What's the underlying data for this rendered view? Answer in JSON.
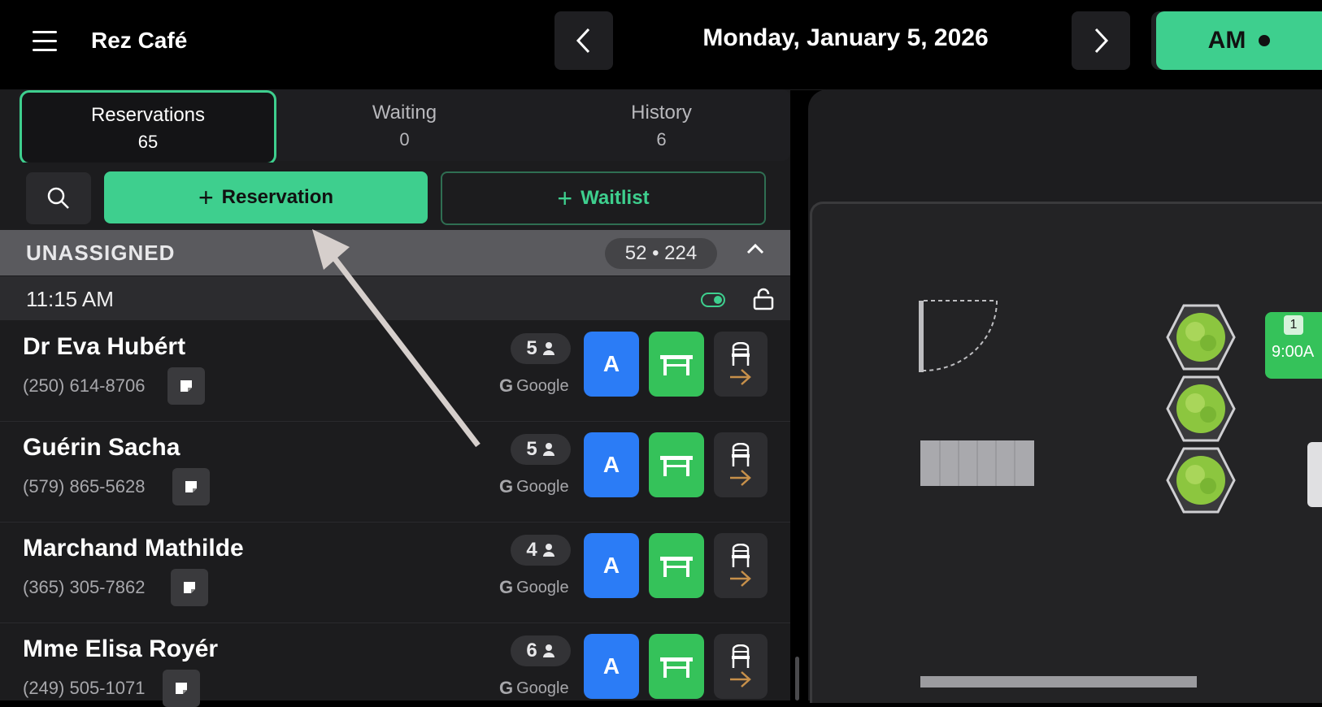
{
  "app": {
    "title": "Rez Café"
  },
  "header": {
    "date": "Monday, January 5, 2026",
    "shift": "AM"
  },
  "tabs": [
    {
      "label": "Reservations",
      "count": "65"
    },
    {
      "label": "Waiting",
      "count": "0"
    },
    {
      "label": "History",
      "count": "6"
    }
  ],
  "toolbar": {
    "reservation_label": "Reservation",
    "waitlist_label": "Waitlist"
  },
  "section": {
    "title": "UNASSIGNED",
    "counts": "52 • 224"
  },
  "timeslot": {
    "time": "11:15 AM"
  },
  "reservations": [
    {
      "name": "Dr Eva Hubért",
      "phone": "(250) 614-8706",
      "party": "5",
      "source": "Google",
      "assign_label": "A"
    },
    {
      "name": "Guérin Sacha",
      "phone": "(579) 865-5628",
      "party": "5",
      "source": "Google",
      "assign_label": "A"
    },
    {
      "name": "Marchand Mathilde",
      "phone": "(365) 305-7862",
      "party": "4",
      "source": "Google",
      "assign_label": "A"
    },
    {
      "name": "Mme Elisa Royér",
      "phone": "(249) 505-1071",
      "party": "6",
      "source": "Google",
      "assign_label": "A"
    }
  ],
  "floorplan": {
    "table_number": "1",
    "table_time": "9:00A"
  },
  "colors": {
    "accent": "#3ecf8e",
    "assign": "#2b7cf6",
    "table": "#35c25a"
  }
}
